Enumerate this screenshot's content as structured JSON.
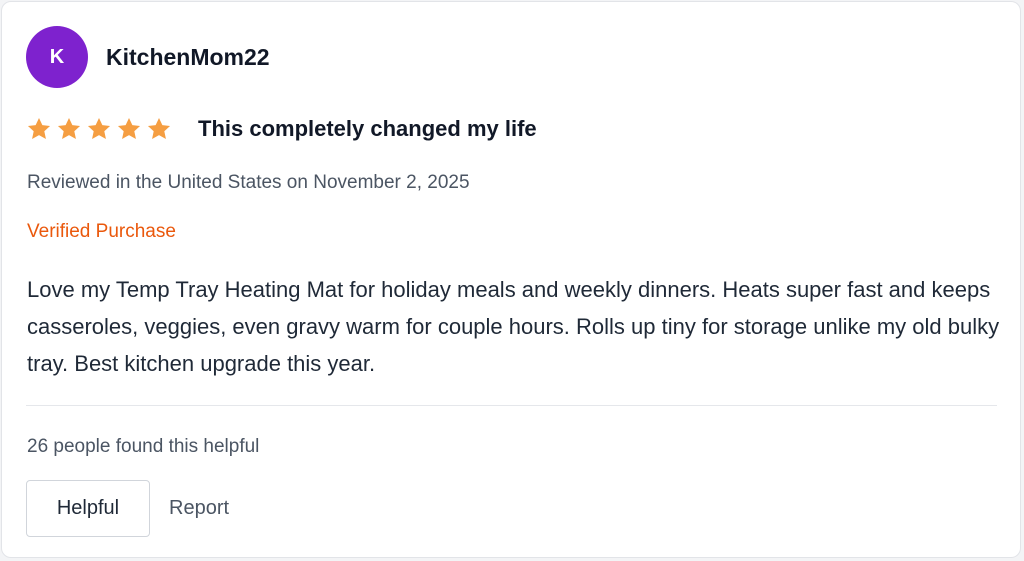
{
  "review": {
    "avatar_initial": "K",
    "username": "KitchenMom22",
    "rating": 5,
    "rating_max": 5,
    "title": "This completely changed my life",
    "meta": "Reviewed in the United States on November 2, 2025",
    "verified_label": "Verified Purchase",
    "body": "Love my Temp Tray Heating Mat for holiday meals and weekly dinners. Heats super fast and keeps casseroles, veggies, even gravy warm for couple hours. Rolls up tiny for storage unlike my old bulky tray. Best kitchen upgrade this year.",
    "helpful_count_text": "26 people found this helpful"
  },
  "actions": {
    "helpful_label": "Helpful",
    "report_label": "Report"
  },
  "colors": {
    "avatar": "#7e22ce",
    "star": "#f59e42",
    "verified": "#ea580c"
  },
  "icons": {
    "star": "star-icon"
  }
}
